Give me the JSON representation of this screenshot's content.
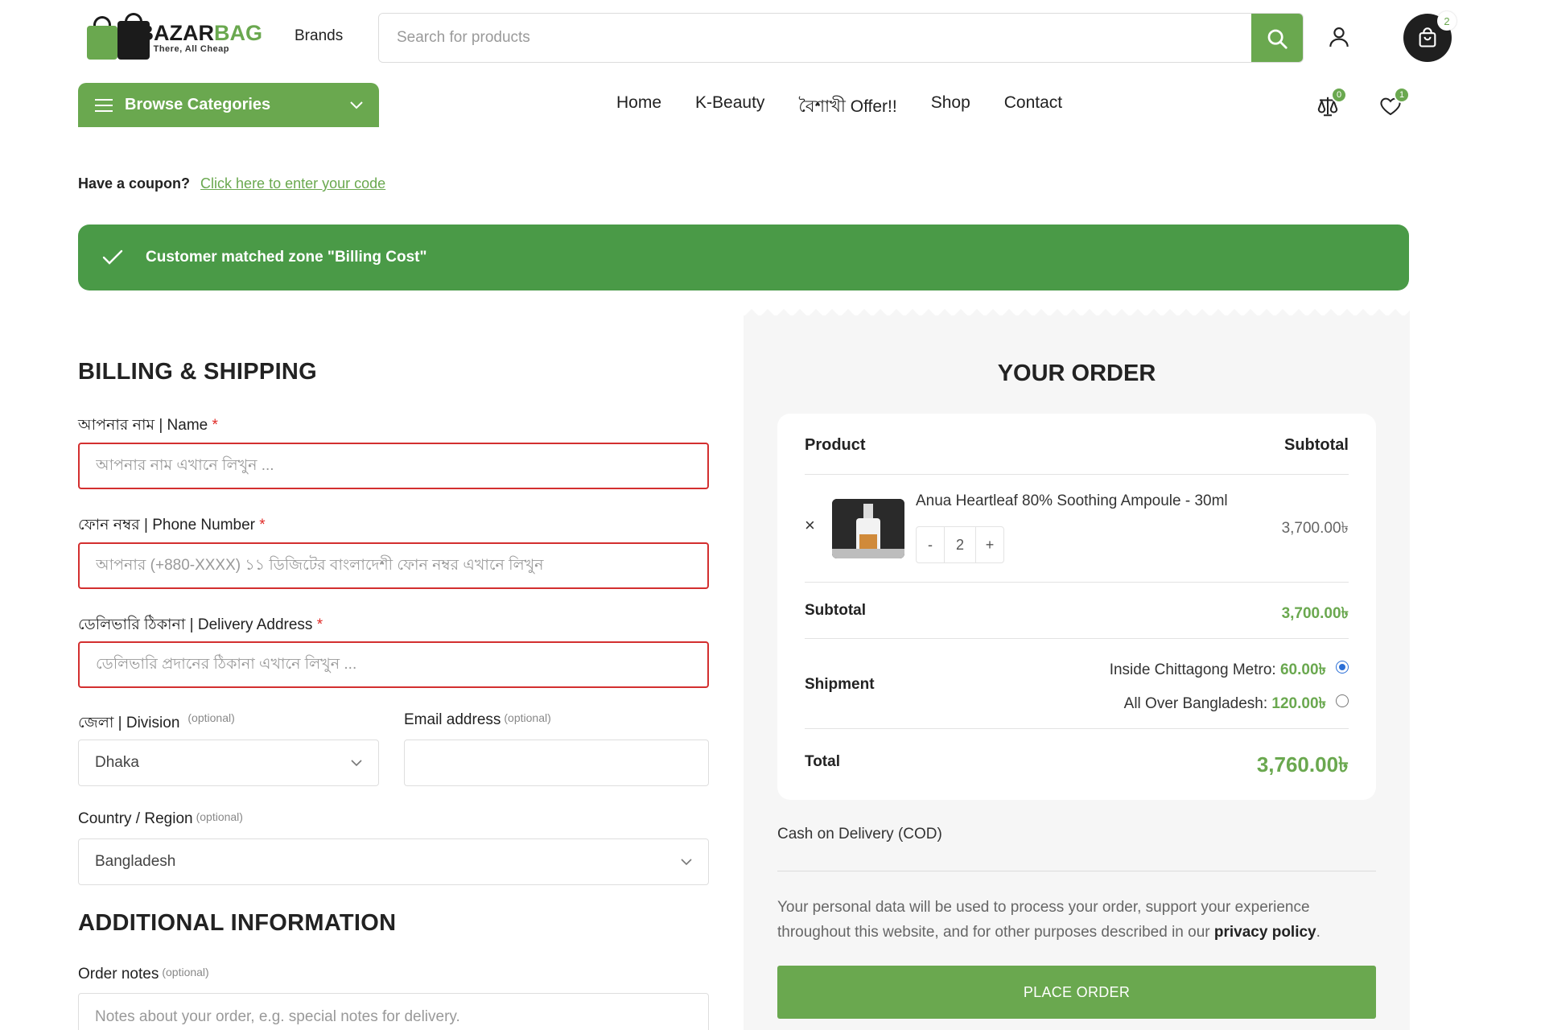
{
  "header": {
    "logo": {
      "name_part1": "BAZAR",
      "name_part2": "BAG",
      "tagline": "All There, All Cheap"
    },
    "brands_link": "Brands",
    "search": {
      "placeholder": "Search for products"
    },
    "cart_count": "2",
    "icons": {
      "search": "search-icon",
      "user": "user-icon",
      "cart": "shopping-bag-icon",
      "compare": "compare-icon",
      "wishlist": "heart-icon",
      "menu": "hamburger-icon",
      "chevron": "chevron-down-icon"
    }
  },
  "nav": {
    "browse_categories": "Browse Categories",
    "items": [
      "Home",
      "K-Beauty",
      "বৈশাখী Offer!!",
      "Shop",
      "Contact"
    ],
    "compare_count": "0",
    "wishlist_count": "1"
  },
  "coupon": {
    "question": "Have a coupon?",
    "link": "Click here to enter your code"
  },
  "notice": {
    "message": "Customer matched zone \"Billing Cost\""
  },
  "billing": {
    "title": "BILLING & SHIPPING",
    "name": {
      "label": "আপনার নাম | Name",
      "required": "*",
      "placeholder": "আপনার নাম এখানে লিখুন ...",
      "value": ""
    },
    "phone": {
      "label": "ফোন নম্বর | Phone Number",
      "required": "*",
      "placeholder": "আপনার (+880-XXXX) ১১ ডিজিটের বাংলাদেশী ফোন নম্বর এখানে লিখুন",
      "value": ""
    },
    "address": {
      "label": "ডেলিভারি ঠিকানা | Delivery Address",
      "required": "*",
      "placeholder": "ডেলিভারি প্রদানের ঠিকানা এখানে লিখুন ...",
      "value": ""
    },
    "division": {
      "label": "জেলা | Division",
      "optional": "(optional)",
      "value": "Dhaka"
    },
    "email": {
      "label": "Email address",
      "optional": "(optional)",
      "value": ""
    },
    "country": {
      "label": "Country / Region",
      "optional": "(optional)",
      "value": "Bangladesh"
    }
  },
  "additional": {
    "title": "ADDITIONAL INFORMATION",
    "notes": {
      "label": "Order notes",
      "optional": "(optional)",
      "placeholder": "Notes about your order, e.g. special notes for delivery.",
      "value": ""
    }
  },
  "order": {
    "title": "YOUR ORDER",
    "col_product": "Product",
    "col_subtotal": "Subtotal",
    "item": {
      "remove": "×",
      "name": "Anua Heartleaf 80% Soothing Ampoule - 30ml",
      "qty_minus": "-",
      "qty": "2",
      "qty_plus": "+",
      "price": "3,700.00৳"
    },
    "subtotal_label": "Subtotal",
    "subtotal_value": "3,700.00৳",
    "shipment_label": "Shipment",
    "shipping_options": [
      {
        "label": "Inside Chittagong Metro:",
        "price": "60.00৳",
        "selected": true
      },
      {
        "label": "All Over Bangladesh:",
        "price": "120.00৳",
        "selected": false
      }
    ],
    "total_label": "Total",
    "total_value": "3,760.00৳",
    "payment_method": "Cash on Delivery (COD)",
    "privacy_text": "Your personal data will be used to process your order, support your experience throughout this website, and for other purposes described in our",
    "privacy_link": "privacy policy",
    "privacy_end": ".",
    "place_order": "PLACE ORDER"
  },
  "colors": {
    "brand_green": "#6aa84f",
    "notice_green": "#4a9a47",
    "error_red": "#d32f2f",
    "panel_gray": "#f6f6f6"
  }
}
